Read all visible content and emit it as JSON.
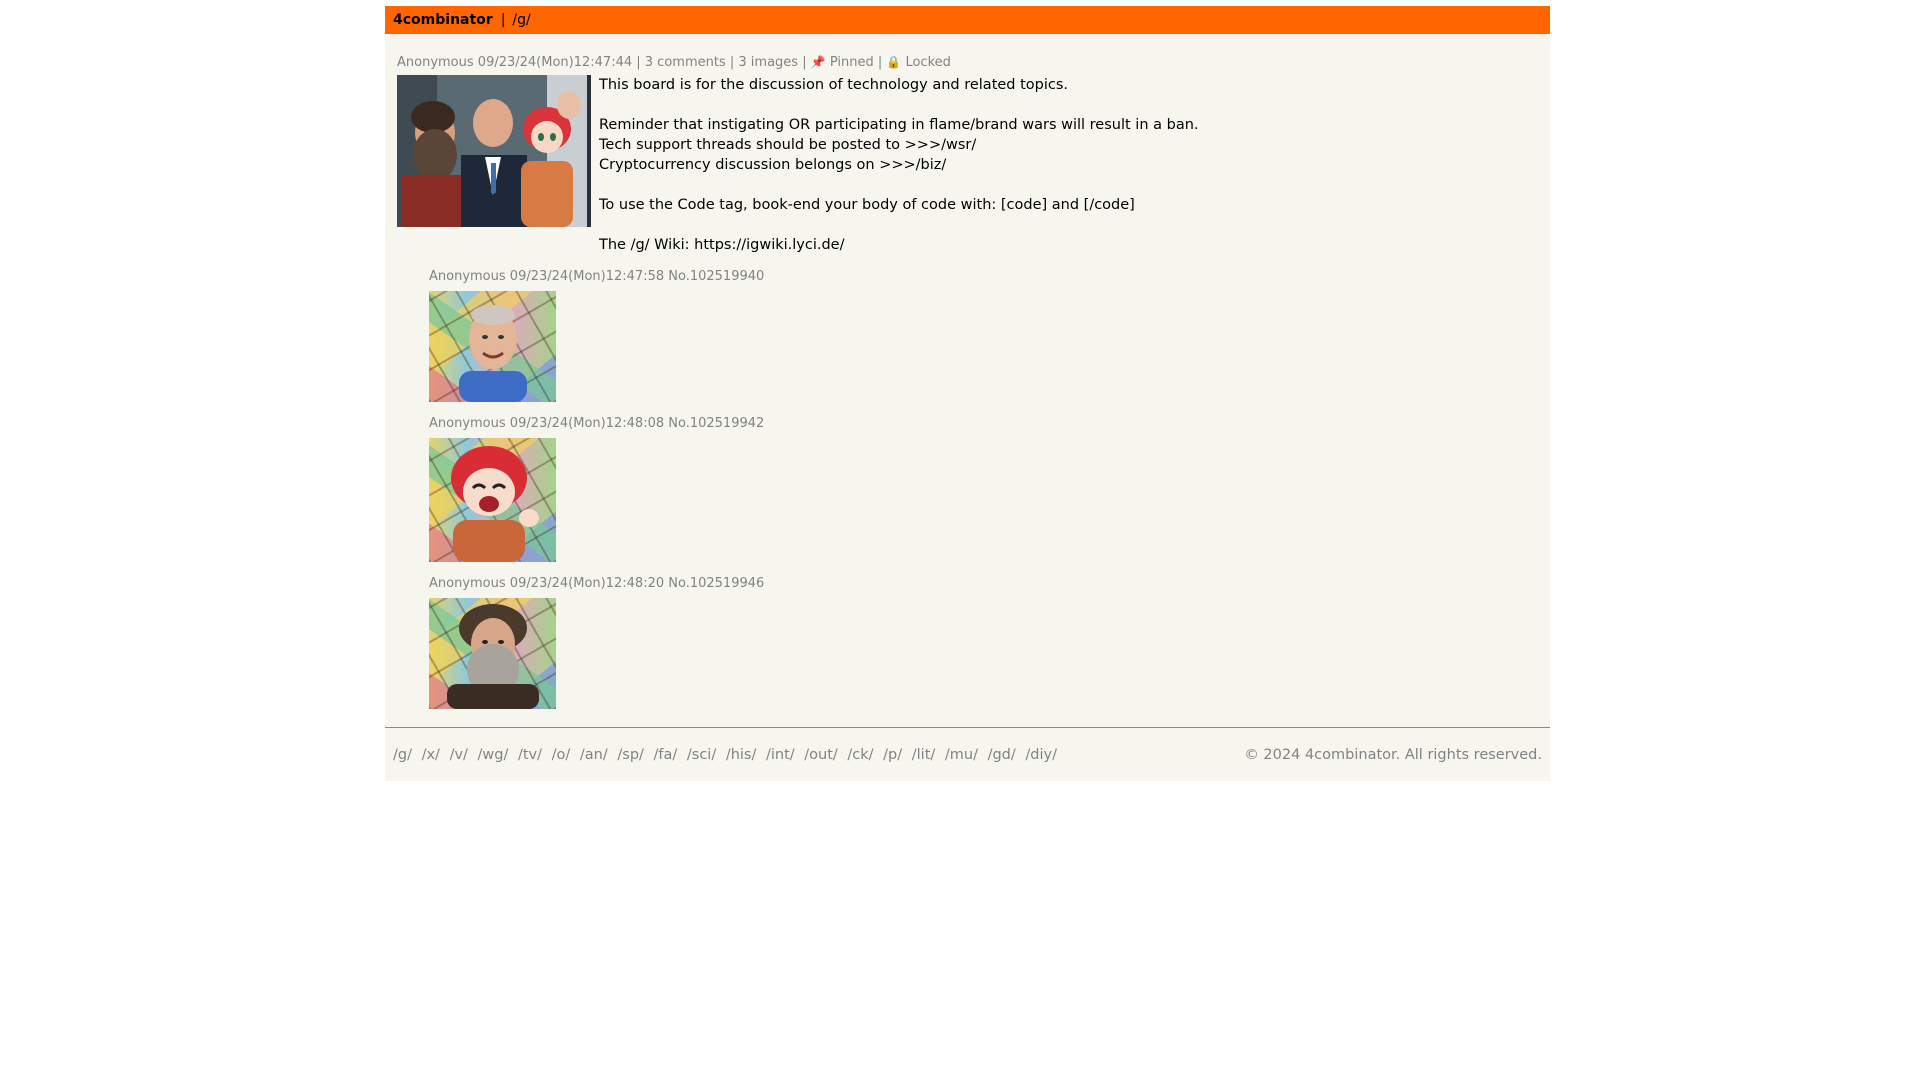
{
  "header": {
    "brand": "4combinator",
    "separator": "|",
    "board": "/g/"
  },
  "thread": {
    "author": "Anonymous",
    "datetime": "09/23/24(Mon)12:47:44",
    "comments": "3 comments",
    "images": "3 images",
    "pinned": "Pinned",
    "locked": "Locked",
    "body": {
      "line1": "This board is for the discussion of technology and related topics.",
      "line2": "Reminder that instigating OR participating in flame/brand wars will result in a ban.",
      "line3": "Tech support threads should be posted to >>>/wsr/",
      "line4": "Cryptocurrency discussion belongs on >>>/biz/",
      "line5": "To use the Code tag, book-end your body of code with: [code] and [/code]",
      "line6": "The /g/ Wiki: https://igwiki.lyci.de/"
    }
  },
  "replies": [
    {
      "author": "Anonymous",
      "datetime": "09/23/24(Mon)12:47:58",
      "number": "No.102519940"
    },
    {
      "author": "Anonymous",
      "datetime": "09/23/24(Mon)12:48:08",
      "number": "No.102519942"
    },
    {
      "author": "Anonymous",
      "datetime": "09/23/24(Mon)12:48:20",
      "number": "No.102519946"
    }
  ],
  "footer": {
    "boards": [
      "/g/",
      "/x/",
      "/v/",
      "/wg/",
      "/tv/",
      "/o/",
      "/an/",
      "/sp/",
      "/fa/",
      "/sci/",
      "/his/",
      "/int/",
      "/out/",
      "/ck/",
      "/p/",
      "/lit/",
      "/mu/",
      "/gd/",
      "/diy/"
    ],
    "copyright": "© 2024 4combinator. All rights reserved."
  },
  "colors": {
    "accent": "#ff6600",
    "background": "#f6f6ef",
    "muted_text": "#828282",
    "pin": "#d0021b"
  },
  "icons": {
    "pinned": "pushpin-icon",
    "locked": "padlock-icon"
  }
}
